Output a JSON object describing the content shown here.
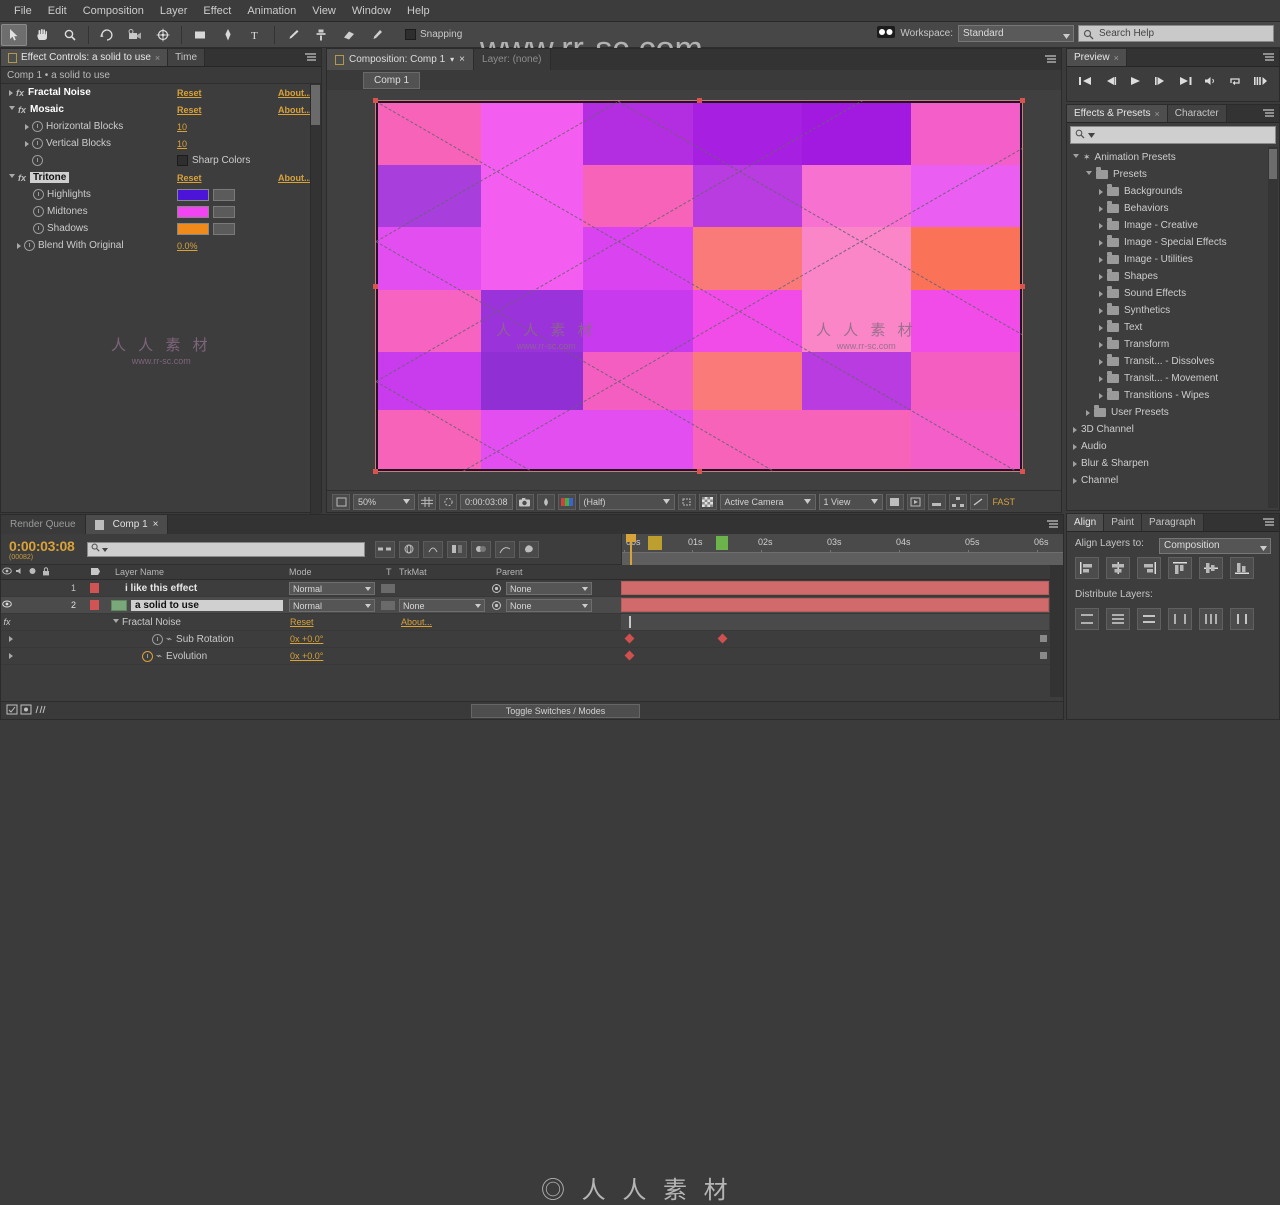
{
  "watermark": {
    "main": "www.rr-sc.com",
    "cn": "人 人 素 材",
    "url": "www.rr-sc.com"
  },
  "menubar": {
    "items": [
      "File",
      "Edit",
      "Composition",
      "Layer",
      "Effect",
      "Animation",
      "View",
      "Window",
      "Help"
    ]
  },
  "toolbar": {
    "snapping_label": "Snapping",
    "workspace_label": "Workspace:",
    "workspace_value": "Standard",
    "search_help_placeholder": "Search Help",
    "tools": [
      "selection-tool",
      "hand-tool",
      "zoom-tool",
      "rotation-tool",
      "camera-tool",
      "pan-behind-tool",
      "shape-tool",
      "pen-tool",
      "text-tool",
      "brush-tool",
      "clone-stamp-tool",
      "eraser-tool",
      "roto-brush-tool",
      "puppet-tool"
    ]
  },
  "effect_controls": {
    "tab_label": "Effect Controls: a solid to use",
    "tab_close": "×",
    "time_label": "Time",
    "header": "Comp 1  •  a solid to use",
    "reset": "Reset",
    "about": "About...",
    "rows": [
      {
        "name": "Fractal Noise",
        "type": "effect",
        "reset": "Reset",
        "about": "About..."
      },
      {
        "name": "Mosaic",
        "type": "effect",
        "reset": "Reset",
        "about": "About..."
      },
      {
        "name": "Horizontal Blocks",
        "type": "param",
        "value": "10"
      },
      {
        "name": "Vertical Blocks",
        "type": "param",
        "value": "10"
      },
      {
        "name": "Sharp Colors",
        "type": "checkbox",
        "value": "Sharp Colors"
      },
      {
        "name": "Tritone",
        "type": "effect",
        "selected": true,
        "reset": "Reset",
        "about": "About..."
      },
      {
        "name": "Highlights",
        "type": "color",
        "swatch": "#4b14d8"
      },
      {
        "name": "Midtones",
        "type": "color",
        "swatch": "#f244f2"
      },
      {
        "name": "Shadows",
        "type": "color",
        "swatch": "#f08a1a"
      },
      {
        "name": "Blend With Original",
        "type": "param",
        "value": "0.0%"
      }
    ]
  },
  "composition": {
    "tab_label": "Composition: Comp 1",
    "tab_close": "×",
    "layer_tab_label": "Layer: (none)",
    "breadcrumb": "Comp 1",
    "toolbar": {
      "zoom": "50%",
      "timecode": "0:00:03:08",
      "resolution": "(Half)",
      "camera": "Active Camera",
      "views": "1 View",
      "fast_preview": "FAST"
    }
  },
  "canvas": {
    "cols": 6,
    "rows": 6,
    "col_widths": [
      0.16,
      0.16,
      0.17,
      0.17,
      0.17,
      0.17
    ],
    "row_heights": [
      0.17,
      0.17,
      0.17,
      0.17,
      0.16,
      0.16
    ],
    "colors": [
      "#f763b8",
      "#f45ef0",
      "#b32ee0",
      "#a71fe0",
      "#a21ae0",
      "#f45ec9",
      "#a83fdd",
      "#f45ef0",
      "#f763b8",
      "#b83ce0",
      "#f771d0",
      "#ea5ef2",
      "#e24ef0",
      "#f45ef0",
      "#d944f0",
      "#fa7a79",
      "#fa86c8",
      "#fa7257",
      "#f763c0",
      "#9b33db",
      "#c73aee",
      "#f14ce8",
      "#fa86c8",
      "#f14ce8",
      "#c93cee",
      "#8f2fd4",
      "#f45ec0",
      "#fa7a79",
      "#b83ce0",
      "#f45ec0",
      "#f763b8",
      "#e24ef0",
      "#e24ef0",
      "#f763b8",
      "#f763b8",
      "#f45ec9"
    ]
  },
  "preview": {
    "tab_label": "Preview",
    "tab_close": "×",
    "buttons": [
      "first-frame",
      "previous-frame",
      "play",
      "next-frame",
      "last-frame",
      "audio",
      "loop",
      "ram-preview"
    ]
  },
  "effects_presets": {
    "tab_label": "Effects & Presets",
    "tab_close": "×",
    "second_tab": "Character",
    "search_placeholder": "",
    "tree": [
      {
        "label": "Animation Presets",
        "depth": 0,
        "open": true,
        "icon": "star"
      },
      {
        "label": "Presets",
        "depth": 1,
        "open": true,
        "icon": "folder"
      },
      {
        "label": "Backgrounds",
        "depth": 2,
        "open": false,
        "icon": "folder"
      },
      {
        "label": "Behaviors",
        "depth": 2,
        "open": false,
        "icon": "folder"
      },
      {
        "label": "Image - Creative",
        "depth": 2,
        "open": false,
        "icon": "folder"
      },
      {
        "label": "Image - Special Effects",
        "depth": 2,
        "open": false,
        "icon": "folder"
      },
      {
        "label": "Image - Utilities",
        "depth": 2,
        "open": false,
        "icon": "folder"
      },
      {
        "label": "Shapes",
        "depth": 2,
        "open": false,
        "icon": "folder"
      },
      {
        "label": "Sound Effects",
        "depth": 2,
        "open": false,
        "icon": "folder"
      },
      {
        "label": "Synthetics",
        "depth": 2,
        "open": false,
        "icon": "folder"
      },
      {
        "label": "Text",
        "depth": 2,
        "open": false,
        "icon": "folder"
      },
      {
        "label": "Transform",
        "depth": 2,
        "open": false,
        "icon": "folder"
      },
      {
        "label": "Transit... - Dissolves",
        "depth": 2,
        "open": false,
        "icon": "folder"
      },
      {
        "label": "Transit... - Movement",
        "depth": 2,
        "open": false,
        "icon": "folder"
      },
      {
        "label": "Transitions - Wipes",
        "depth": 2,
        "open": false,
        "icon": "folder"
      },
      {
        "label": "User Presets",
        "depth": 1,
        "open": false,
        "icon": "folder"
      },
      {
        "label": "3D Channel",
        "depth": 0,
        "open": false,
        "icon": "none"
      },
      {
        "label": "Audio",
        "depth": 0,
        "open": false,
        "icon": "none"
      },
      {
        "label": "Blur & Sharpen",
        "depth": 0,
        "open": false,
        "icon": "none"
      },
      {
        "label": "Channel",
        "depth": 0,
        "open": false,
        "icon": "none"
      }
    ]
  },
  "align": {
    "tabs": [
      "Align",
      "Paint",
      "Paragraph"
    ],
    "align_layers_label": "Align Layers to:",
    "align_layers_value": "Composition",
    "distribute_label": "Distribute Layers:"
  },
  "timeline": {
    "render_queue_tab": "Render Queue",
    "comp_tab": "Comp 1",
    "tab_close": "×",
    "timecode": "0:00:03:08",
    "timecode_sub": "(00082)",
    "search_placeholder": "",
    "columns": {
      "layer_name": "Layer Name",
      "mode": "Mode",
      "trkmat": "TrkMat",
      "parent": "Parent",
      "t": "T"
    },
    "ruler_ticks": [
      "00s",
      "01s",
      "02s",
      "03s",
      "04s",
      "05s",
      "06s"
    ],
    "layers": [
      {
        "index": "1",
        "name": "i like this effect",
        "mode": "Normal",
        "trkmat": "",
        "parent": "None",
        "swatch": "#d05454",
        "selected": false
      },
      {
        "index": "2",
        "name": "a solid to use",
        "mode": "Normal",
        "trkmat": "None",
        "parent": "None",
        "swatch": "#d05454",
        "selected": true
      }
    ],
    "properties": [
      {
        "label": "Fractal Noise",
        "depth": 1,
        "reset": "Reset",
        "about": "About..."
      },
      {
        "label": "Sub Rotation",
        "depth": 3,
        "value": "0x +0.0°"
      },
      {
        "label": "Evolution",
        "depth": 3,
        "value": "0x +0.0°"
      }
    ],
    "footer_toggle": "Toggle Switches / Modes"
  },
  "colors": {
    "accent": "#d8a23a",
    "selection": "#d07b7b",
    "layer_bar": "#d16a6a"
  }
}
